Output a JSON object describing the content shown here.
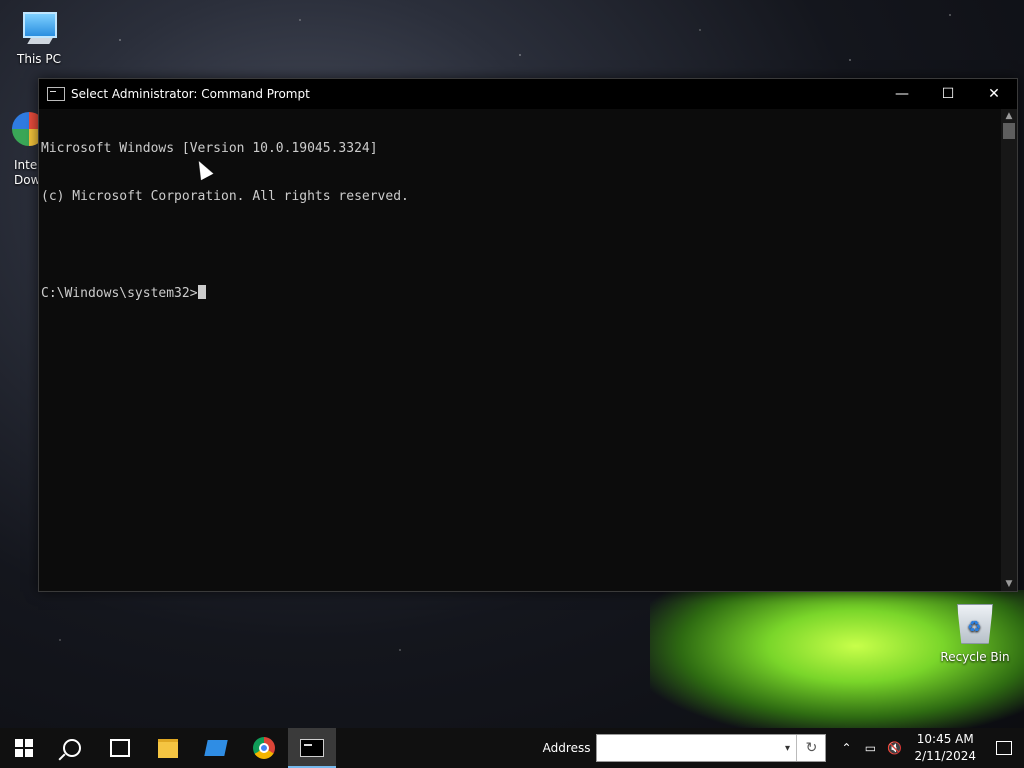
{
  "desktop": {
    "icons": [
      {
        "label": "This PC"
      },
      {
        "label": "Recycle Bin"
      }
    ],
    "partial_icon_lines": [
      "Inte",
      "Dow"
    ]
  },
  "window": {
    "title": "Select Administrator: Command Prompt",
    "controls": {
      "minimize": "—",
      "maximize": "☐",
      "close": "✕"
    },
    "console_lines": [
      "Microsoft Windows [Version 10.0.19045.3324]",
      "(c) Microsoft Corporation. All rights reserved.",
      "",
      "C:\\Windows\\system32>"
    ]
  },
  "taskbar": {
    "address_label": "Address",
    "address_value": "",
    "clock_time": "10:45 AM",
    "clock_date": "2/11/2024"
  }
}
